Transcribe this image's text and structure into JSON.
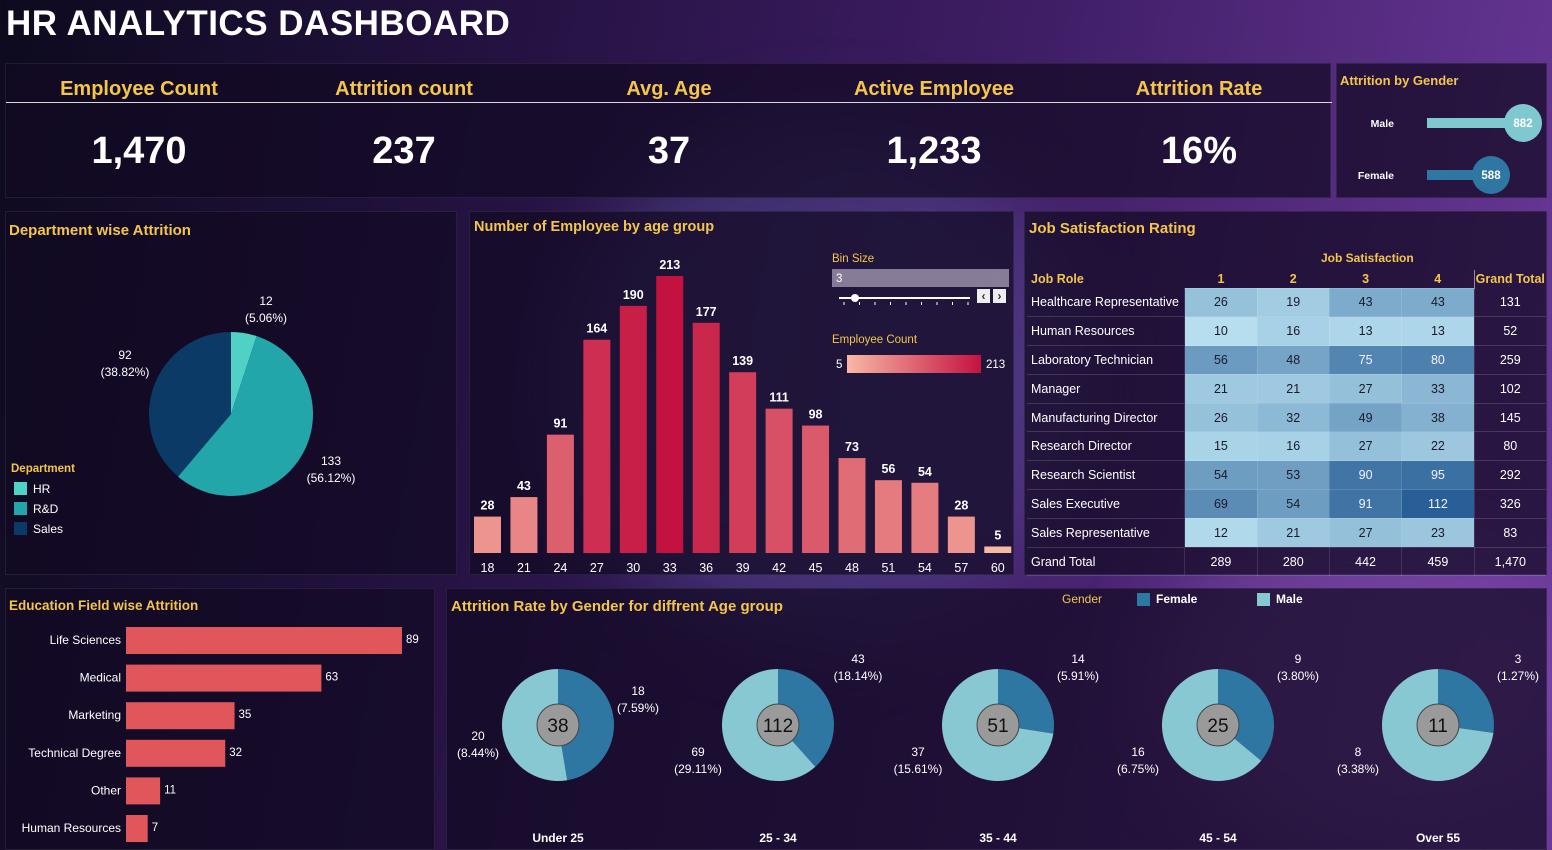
{
  "title": "HR ANALYTICS DASHBOARD",
  "kpis": [
    {
      "label": "Employee Count",
      "value": "1,470"
    },
    {
      "label": "Attrition count",
      "value": "237"
    },
    {
      "label": "Avg. Age",
      "value": "37"
    },
    {
      "label": "Active Employee",
      "value": "1,233"
    },
    {
      "label": "Attrition Rate",
      "value": "16%"
    }
  ],
  "colors": {
    "accent_gold": "#f3c64a",
    "hr": "#4fd1c5",
    "rnd": "#22a6a9",
    "sales": "#0b3a66",
    "bar_red": "#e05a5a",
    "female": "#2f77a3",
    "male": "#88c8d2"
  },
  "chart_data": [
    {
      "type": "bar",
      "id": "attrition_by_gender",
      "title": "Attrition by Gender",
      "categories": [
        "Male",
        "Female"
      ],
      "values": [
        882,
        588
      ]
    },
    {
      "type": "pie",
      "id": "department_attrition",
      "title": "Department wise Attrition",
      "legend_title": "Department",
      "slices": [
        {
          "label": "HR",
          "value": 12,
          "pct": "(5.06%)",
          "color": "#4fd1c5"
        },
        {
          "label": "R&D",
          "value": 133,
          "pct": "(56.12%)",
          "color": "#22a6a9"
        },
        {
          "label": "Sales",
          "value": 92,
          "pct": "(38.82%)",
          "color": "#0b3a66"
        }
      ]
    },
    {
      "type": "bar",
      "id": "employees_by_age",
      "title": "Number of Employee by age group",
      "categories": [
        "18",
        "21",
        "24",
        "27",
        "30",
        "33",
        "36",
        "39",
        "42",
        "45",
        "48",
        "51",
        "54",
        "57",
        "60"
      ],
      "values": [
        28,
        43,
        91,
        164,
        190,
        213,
        177,
        139,
        111,
        98,
        73,
        56,
        54,
        28,
        5
      ],
      "ylim": [
        0,
        213
      ],
      "bin_size_label": "Bin Size",
      "bin_size_value": "3",
      "color_legend_title": "Employee Count",
      "color_min": "5",
      "color_max": "213"
    },
    {
      "type": "table",
      "id": "job_satisfaction",
      "title": "Job Satisfaction Rating",
      "column_group_label": "Job Satisfaction",
      "row_header": "Job Role",
      "columns": [
        "1",
        "2",
        "3",
        "4"
      ],
      "total_header": "Grand Total",
      "rows": [
        {
          "role": "Healthcare Representative",
          "values": [
            26,
            19,
            43,
            43
          ],
          "total": "131"
        },
        {
          "role": "Human Resources",
          "values": [
            10,
            16,
            13,
            13
          ],
          "total": "52"
        },
        {
          "role": "Laboratory Technician",
          "values": [
            56,
            48,
            75,
            80
          ],
          "total": "259"
        },
        {
          "role": "Manager",
          "values": [
            21,
            21,
            27,
            33
          ],
          "total": "102"
        },
        {
          "role": "Manufacturing Director",
          "values": [
            26,
            32,
            49,
            38
          ],
          "total": "145"
        },
        {
          "role": "Research Director",
          "values": [
            15,
            16,
            27,
            22
          ],
          "total": "80"
        },
        {
          "role": "Research Scientist",
          "values": [
            54,
            53,
            90,
            95
          ],
          "total": "292"
        },
        {
          "role": "Sales Executive",
          "values": [
            69,
            54,
            91,
            112
          ],
          "total": "326"
        },
        {
          "role": "Sales Representative",
          "values": [
            12,
            21,
            27,
            23
          ],
          "total": "83"
        }
      ],
      "grand_total_label": "Grand Total",
      "grand_totals": [
        "289",
        "280",
        "442",
        "459",
        "1,470"
      ]
    },
    {
      "type": "bar",
      "id": "education_field_attrition",
      "title": "Education Field wise Attrition",
      "categories": [
        "Life Sciences",
        "Medical",
        "Marketing",
        "Technical Degree",
        "Other",
        "Human Resources"
      ],
      "values": [
        89,
        63,
        35,
        32,
        11,
        7
      ]
    },
    {
      "type": "pie",
      "id": "attrition_gender_age",
      "title": "Attrition Rate by Gender for diffrent Age group",
      "legend_title": "Gender",
      "legend": [
        "Female",
        "Male"
      ],
      "groups": [
        {
          "label": "Under 25",
          "total": "38",
          "female": {
            "value": 18,
            "pct": "(7.59%)"
          },
          "male": {
            "value": 20,
            "pct": "(8.44%)"
          }
        },
        {
          "label": "25 - 34",
          "total": "112",
          "female": {
            "value": 43,
            "pct": "(18.14%)"
          },
          "male": {
            "value": 69,
            "pct": "(29.11%)"
          }
        },
        {
          "label": "35 - 44",
          "total": "51",
          "female": {
            "value": 14,
            "pct": "(5.91%)"
          },
          "male": {
            "value": 37,
            "pct": "(15.61%)"
          }
        },
        {
          "label": "45 - 54",
          "total": "25",
          "female": {
            "value": 9,
            "pct": "(3.80%)"
          },
          "male": {
            "value": 16,
            "pct": "(6.75%)"
          }
        },
        {
          "label": "Over 55",
          "total": "11",
          "female": {
            "value": 3,
            "pct": "(1.27%)"
          },
          "male": {
            "value": 8,
            "pct": "(3.38%)"
          }
        }
      ]
    }
  ]
}
